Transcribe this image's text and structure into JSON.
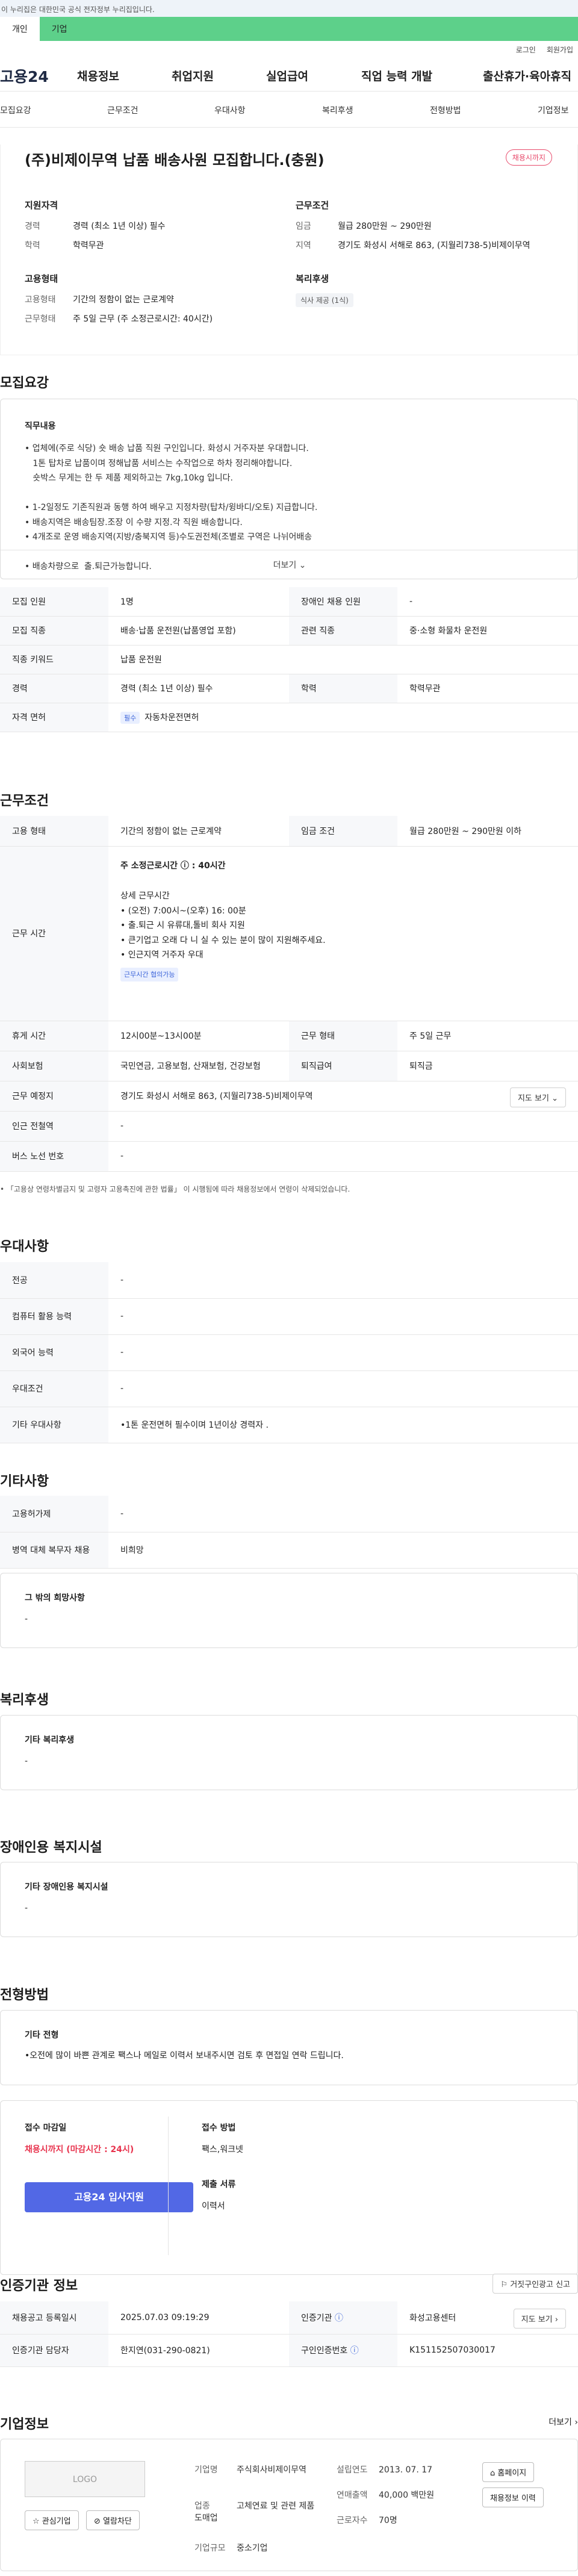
{
  "topbar": {
    "text": "이 누리집은 대한민국 공식 전자정부 누리집입니다."
  },
  "tabs": [
    "개인",
    "기업"
  ],
  "util": [
    "로그인",
    "회원가입"
  ],
  "logo": "고용24",
  "gnb": [
    "채용정보",
    "취업지원",
    "실업급여",
    "직업 능력 개발",
    "출산휴가·육아휴직"
  ],
  "snb": [
    "모집요강",
    "근무조건",
    "우대사항",
    "복리후생",
    "전형방법",
    "기업정보"
  ],
  "summary": {
    "title": "(주)비제이무역 납품 배송사원 모집합니다.(충원)",
    "badge": "채용시까지",
    "qual_title": "지원자격",
    "career_k": "경력",
    "career_v": "경력 (최소 1년 이상) 필수",
    "edu_k": "학력",
    "edu_v": "학력무관",
    "emp_title": "고용형태",
    "emp_k": "고용형태",
    "emp_v": "기간의 정함이 없는 근로계약",
    "work_k": "근무형태",
    "work_v": "주 5일 근무 (주 소정근로시간: 40시간)",
    "cond_title": "근무조건",
    "wage_k": "임금",
    "wage_v": "월급 280만원 ~ 290만원",
    "area_k": "지역",
    "area_v": "경기도 화성시 서해로 863, (지월리738-5)비제이무역",
    "wel_title": "복리후생",
    "wel_chip": "식사 제공 (1식)"
  },
  "recruit": {
    "title": "모집요강",
    "duty_title": "직무내용",
    "duty": "• 업체에(주로 식당) 숏 배송 납품 직원 구인입니다. 화성시 거주자분 우대합니다.\n   1톤 탑차로 납품이며 정해납품 서비스는 수작업으로 하차 정리해야합니다.\n   숏박스 무게는 한 두 제품 제외하고는 7kg,10kg 입니다.\n\n• 1-2일정도 기존직원과 동행 하여 배우고 지정차량(탑차/윙바디/오토) 지급합니다.\n• 배송지역은 배송팀장.조장 이 수량 지정.각 직원 배송합니다.\n• 4개조로 운영 배송지역(지방/충북지역 등)수도권전체(조별로 구역은 나뉘어배송\n\n• 배송차량으로  출.퇴근가능합니다.",
    "more": "더보기",
    "rows": [
      {
        "k": "모집 인원",
        "v": "1명",
        "k2": "장애인 채용 인원",
        "v2": "-"
      },
      {
        "k": "모집 직종",
        "v": "배송·납품 운전원(납품영업 포함)",
        "k2": "관련 직종",
        "v2": "중·소형 화물차 운전원"
      },
      {
        "k": "직종 키워드",
        "v": "납품 운전원",
        "k2": "",
        "v2": ""
      },
      {
        "k": "경력",
        "v": "경력 (최소 1년 이상) 필수",
        "k2": "학력",
        "v2": "학력무관"
      },
      {
        "k": "자격 면허",
        "v": "자동차운전면허",
        "tag": "필수",
        "k2": "",
        "v2": ""
      }
    ]
  },
  "work": {
    "title": "근무조건",
    "emp_k": "고용 형태",
    "emp_v": "기간의 정함이 없는 근로계약",
    "wage_k": "임금 조건",
    "wage_v": "월급 280만원 ~ 290만원 이하",
    "time_k": "근무 시간",
    "time_week": "주 소정근로시간 ⓘ : 40시간",
    "time_detail": "상세 근무시간\n• (오전) 7:00시~(오후) 16: 00분\n• 출.퇴근 시 유류대,톨비 회사 지원\n• 큰기업고 오래 다 니 실 수 있는 분이 많이 지원해주세요.\n• 인근지역 거주자 우대",
    "time_chip": "근무시간 협의가능",
    "rest_k": "휴게 시간",
    "rest_v": "12시00분~13시00분",
    "wtype_k": "근무 형태",
    "wtype_v": "주 5일 근무",
    "ins_k": "사회보험",
    "ins_v": "국민연금, 고용보험, 산재보험, 건강보험",
    "ret_k": "퇴직급여",
    "ret_v": "퇴직금",
    "place_k": "근무 예정지",
    "place_v": "경기도 화성시 서해로 863, (지월리738-5)비제이무역",
    "map_btn": "지도 보기",
    "sub_k": "인근 전철역",
    "sub_v": "-",
    "bus_k": "버스 노선 번호",
    "bus_v": "-",
    "note": "• 「고용상 연령차별금지 및 고령자 고용촉진에 관한 법률」 이 시행됨에 따라 채용정보에서 연령이 삭제되었습니다."
  },
  "pref": {
    "title": "우대사항",
    "rows": [
      {
        "k": "전공",
        "v": "-"
      },
      {
        "k": "컴퓨터 활용 능력",
        "v": "-"
      },
      {
        "k": "외국어 능력",
        "v": "-"
      },
      {
        "k": "우대조건",
        "v": "-"
      },
      {
        "k": "기타 우대사항",
        "v": "•1톤 운전면허 필수이며 1년이상 경력자 ."
      }
    ]
  },
  "etc": {
    "title": "기타사항",
    "rows": [
      {
        "k": "고용허가제",
        "v": "-"
      },
      {
        "k": "병역 대체 복무자 채용",
        "v": "비희망"
      }
    ],
    "other_title": "그 밖의 희망사항",
    "other_v": "-"
  },
  "welfare": {
    "title": "복리후생",
    "sub": "기타 복리후생",
    "v": "-"
  },
  "disab": {
    "title": "장애인용 복지시설",
    "sub": "기타 장애인용 복지시설",
    "v": "-"
  },
  "process": {
    "title": "전형방법",
    "sub": "기타 전형",
    "v": "•오전에 많이 바쁜 관계로 팩스나 메일로 이력서 보내주시면 검토 후 면접일 연락 드립니다."
  },
  "apply": {
    "deadline_k": "접수 마감일",
    "deadline_v": "채용시까지 (마감시간 : 24시)",
    "btn": "고용24 입사지원",
    "method_k": "접수 방법",
    "method_v": "팩스,워크넷",
    "doc_k": "제출 서류",
    "doc_v": "이력서"
  },
  "agency": {
    "title": "인증기관 정보",
    "report_btn": "거짓구인광고 신고",
    "reg_k": "채용공고 등록일시",
    "reg_v": "2025.07.03 09:19:29",
    "org_k": "인증기관",
    "org_v": "화성고용센터",
    "map_btn": "지도 보기",
    "mgr_k": "인증기관 담당자",
    "mgr_v": "한지연(031-290-0821)",
    "no_k": "구인인증번호",
    "no_v": "K151152507030017"
  },
  "company": {
    "title": "기업정보",
    "more": "더보기",
    "logo": "LOGO",
    "fav": "관심기업",
    "block": "열람차단",
    "name_k": "기업명",
    "name_v": "주식회사비제이무역",
    "ind_k": "업종",
    "ind_v": "고체연료 및 관련 제품 도매업",
    "size_k": "기업규모",
    "size_v": "중소기업",
    "est_k": "설립연도",
    "est_v": "2013. 07. 17",
    "sales_k": "연매출액",
    "sales_v": "40,000 백만원",
    "emp_k": "근로자수",
    "emp_v": "70명",
    "home_btn": "홈페이지",
    "jobs_btn": "채용정보 이력"
  }
}
